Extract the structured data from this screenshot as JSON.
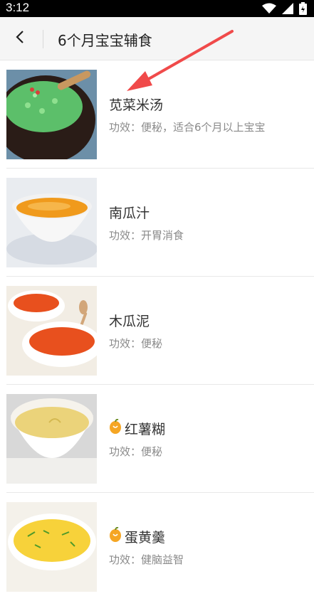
{
  "status_bar": {
    "time": "3:12"
  },
  "header": {
    "title": "6个月宝宝辅食"
  },
  "effect_prefix": "功效：",
  "recipes": [
    {
      "name": "苋菜米汤",
      "effect": "便秘，适合6个月以上宝宝",
      "badge": false
    },
    {
      "name": "南瓜汁",
      "effect": "开胃消食",
      "badge": false
    },
    {
      "name": "木瓜泥",
      "effect": "便秘",
      "badge": false
    },
    {
      "name": "红薯糊",
      "effect": "便秘",
      "badge": true
    },
    {
      "name": "蛋黄羹",
      "effect": "健脑益智",
      "badge": true
    }
  ],
  "colors": {
    "arrow": "#f04a4a",
    "badge": "#f5a623"
  }
}
